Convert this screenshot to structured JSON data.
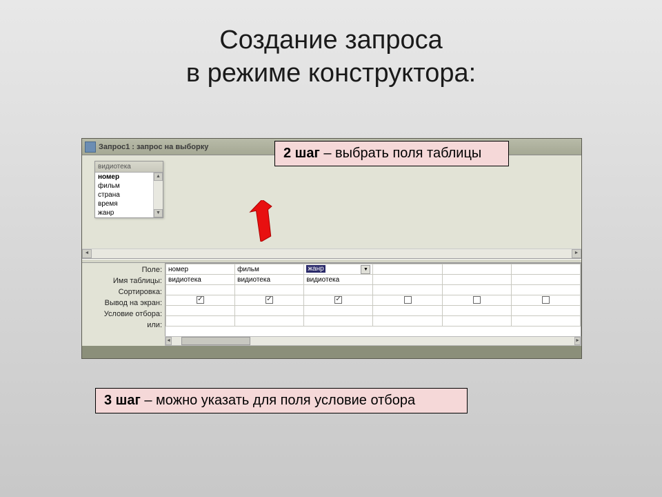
{
  "slide": {
    "title_line1": "Создание запроса",
    "title_line2": "в режиме конструктора:"
  },
  "callouts": {
    "step2_bold": "2 шаг",
    "step2_rest": " – выбрать поля таблицы",
    "step3_bold": "3 шаг",
    "step3_rest": " – можно указать для поля условие отбора"
  },
  "window": {
    "title": "Запрос1 : запрос на выборку"
  },
  "source_table": {
    "name": "видиотека",
    "fields": [
      "номер",
      "фильм",
      "страна",
      "время",
      "жанр"
    ],
    "selected_index": 0
  },
  "grid": {
    "row_labels": [
      "Поле:",
      "Имя таблицы:",
      "Сортировка:",
      "Вывод на экран:",
      "Условие отбора:",
      "или:"
    ],
    "columns": [
      {
        "field": "номер",
        "table": "видиотека",
        "sort": "",
        "show": true,
        "criteria": "",
        "or": "",
        "active": false
      },
      {
        "field": "фильм",
        "table": "видиотека",
        "sort": "",
        "show": true,
        "criteria": "",
        "or": "",
        "active": false
      },
      {
        "field": "жанр",
        "table": "видиотека",
        "sort": "",
        "show": true,
        "criteria": "",
        "or": "",
        "active": true
      },
      {
        "field": "",
        "table": "",
        "sort": "",
        "show": false,
        "criteria": "",
        "or": "",
        "active": false
      },
      {
        "field": "",
        "table": "",
        "sort": "",
        "show": false,
        "criteria": "",
        "or": "",
        "active": false
      },
      {
        "field": "",
        "table": "",
        "sort": "",
        "show": false,
        "criteria": "",
        "or": "",
        "active": false
      }
    ]
  }
}
